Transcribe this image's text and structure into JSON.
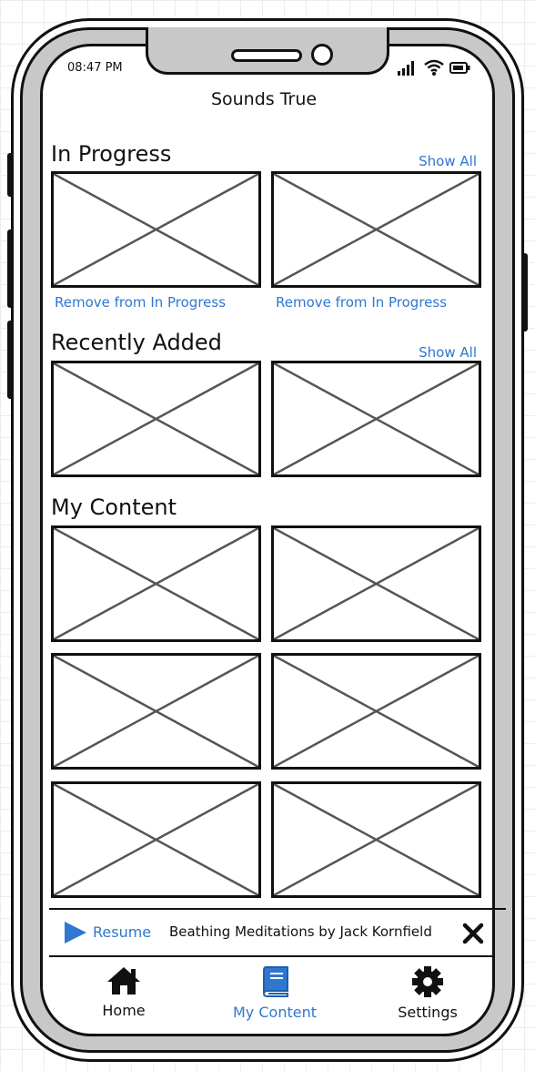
{
  "status_bar": {
    "time": "08:47 PM"
  },
  "app": {
    "title": "Sounds True"
  },
  "sections": {
    "in_progress": {
      "title": "In Progress",
      "show_all": "Show All",
      "items": [
        {
          "remove_label": "Remove from In Progress"
        },
        {
          "remove_label": "Remove from In Progress"
        }
      ]
    },
    "recently_added": {
      "title": "Recently Added",
      "show_all": "Show All"
    },
    "my_content": {
      "title": "My Content"
    }
  },
  "player": {
    "resume_label": "Resume",
    "now_playing": "Beathing Meditations by Jack Kornfield"
  },
  "tabs": [
    {
      "label": "Home",
      "icon": "home-icon"
    },
    {
      "label": "My Content",
      "icon": "book-icon",
      "active": true
    },
    {
      "label": "Settings",
      "icon": "gear-icon"
    }
  ],
  "colors": {
    "link": "#2f77d0",
    "outline": "#111111",
    "bezel": "#c8c8c8",
    "placeholder_x": "#555555"
  }
}
